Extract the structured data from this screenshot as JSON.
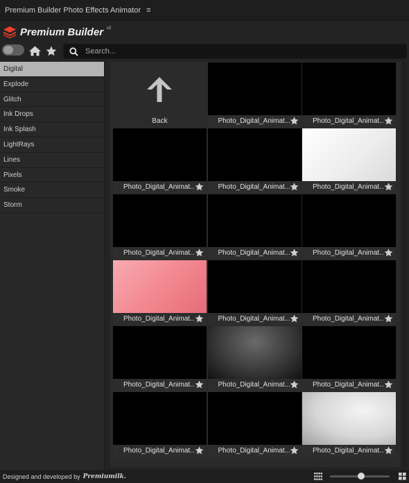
{
  "window": {
    "title": "Premium Builder Photo Effects Animator",
    "menu_glyph": "≡"
  },
  "brand": {
    "name": "Premium Builder",
    "version": "v2"
  },
  "search": {
    "placeholder": "Search..."
  },
  "sidebar": {
    "items": [
      {
        "label": "Digital",
        "active": true
      },
      {
        "label": "Explode"
      },
      {
        "label": "Glitch"
      },
      {
        "label": "Ink Drops"
      },
      {
        "label": "Ink Splash"
      },
      {
        "label": "LightRays"
      },
      {
        "label": "Lines"
      },
      {
        "label": "Pixels"
      },
      {
        "label": "Smoke"
      },
      {
        "label": "Storm"
      }
    ]
  },
  "grid": {
    "back_label": "Back",
    "tiles": [
      {
        "label": "Photo_Digital_Animat..."
      },
      {
        "label": "Photo_Digital_Animat..."
      },
      {
        "label": "Photo_Digital_Animat..."
      },
      {
        "label": "Photo_Digital_Animat..."
      },
      {
        "label": "Photo_Digital_Animat..."
      },
      {
        "label": "Photo_Digital_Animat..."
      },
      {
        "label": "Photo_Digital_Animat..."
      },
      {
        "label": "Photo_Digital_Animat..."
      },
      {
        "label": "Photo_Digital_Animat..."
      },
      {
        "label": "Photo_Digital_Animat..."
      },
      {
        "label": "Photo_Digital_Animat..."
      },
      {
        "label": "Photo_Digital_Animat..."
      },
      {
        "label": "Photo_Digital_Animat..."
      },
      {
        "label": "Photo_Digital_Animat..."
      },
      {
        "label": "Photo_Digital_Animat..."
      },
      {
        "label": "Photo_Digital_Animat..."
      },
      {
        "label": "Photo_Digital_Animat..."
      }
    ]
  },
  "footer": {
    "credit": "Designed and developed by",
    "company": "Premiumilk."
  },
  "colors": {
    "accent": "#e8412c",
    "active_item": "#b4b4b4",
    "background": "#232323"
  },
  "icons": {
    "logo": "stack-layers-logo",
    "home": "home-icon",
    "star": "star-icon",
    "search": "search-icon",
    "back": "arrow-up-icon",
    "grid_small": "grid-small-icon",
    "grid_large": "grid-large-icon"
  }
}
